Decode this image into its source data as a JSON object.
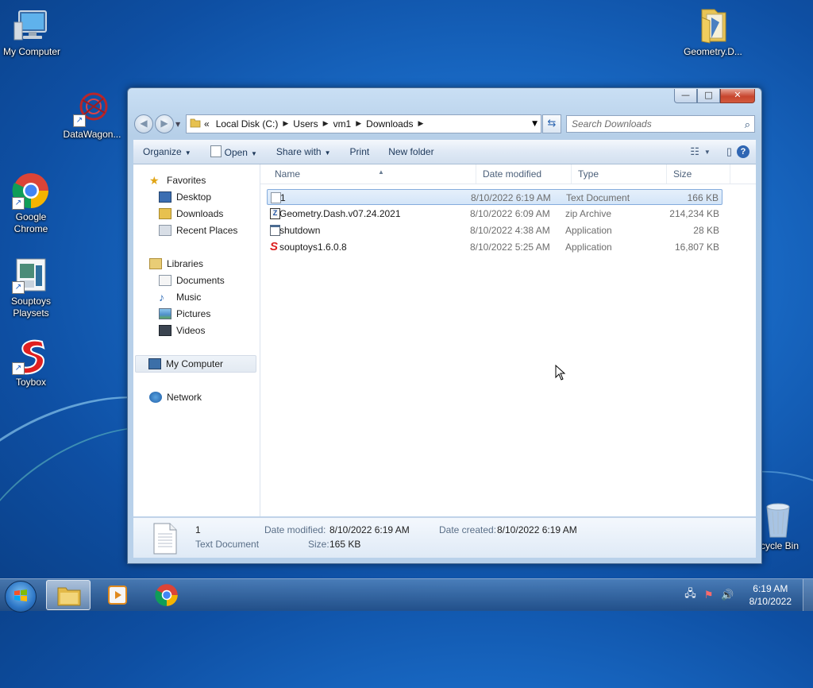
{
  "desktop": {
    "icons": [
      {
        "label": "My Computer"
      },
      {
        "label": "DataWagon..."
      },
      {
        "label": "Google Chrome"
      },
      {
        "label": "Souptoys Playsets"
      },
      {
        "label": "Toybox"
      },
      {
        "label": "Geometry.D..."
      },
      {
        "label": "cycle Bin"
      }
    ]
  },
  "window": {
    "controls": {
      "minimize": "—",
      "maximize": "□",
      "close": "✕"
    },
    "address": {
      "prefix": "«",
      "crumbs": [
        "Local Disk (C:)",
        "Users",
        "vm1",
        "Downloads"
      ]
    },
    "search_placeholder": "Search Downloads",
    "toolbar": {
      "organize": "Organize",
      "open": "Open",
      "share_with": "Share with",
      "print": "Print",
      "new_folder": "New folder"
    },
    "nav": {
      "favorites": "Favorites",
      "desktop": "Desktop",
      "downloads": "Downloads",
      "recent_places": "Recent Places",
      "libraries": "Libraries",
      "documents": "Documents",
      "music": "Music",
      "pictures": "Pictures",
      "videos": "Videos",
      "my_computer": "My Computer",
      "network": "Network"
    },
    "columns": [
      "Name",
      "Date modified",
      "Type",
      "Size"
    ],
    "files": [
      {
        "name": "1",
        "date": "8/10/2022 6:19 AM",
        "type": "Text Document",
        "size": "166 KB",
        "icon": "text-file-icon"
      },
      {
        "name": "Geometry.Dash.v07.24.2021",
        "date": "8/10/2022 6:09 AM",
        "type": "zip Archive",
        "size": "214,234 KB",
        "icon": "zip-icon"
      },
      {
        "name": "shutdown",
        "date": "8/10/2022 4:38 AM",
        "type": "Application",
        "size": "28 KB",
        "icon": "application-icon"
      },
      {
        "name": "souptoys1.6.0.8",
        "date": "8/10/2022 5:25 AM",
        "type": "Application",
        "size": "16,807 KB",
        "icon": "souptoys-icon"
      }
    ],
    "details": {
      "name": "1",
      "type": "Text Document",
      "date_modified_label": "Date modified:",
      "date_modified": "8/10/2022 6:19 AM",
      "date_created_label": "Date created:",
      "date_created": "8/10/2022 6:19 AM",
      "size_label": "Size:",
      "size": "165 KB"
    }
  },
  "taskbar": {
    "clock_time": "6:19 AM",
    "clock_date": "8/10/2022"
  }
}
